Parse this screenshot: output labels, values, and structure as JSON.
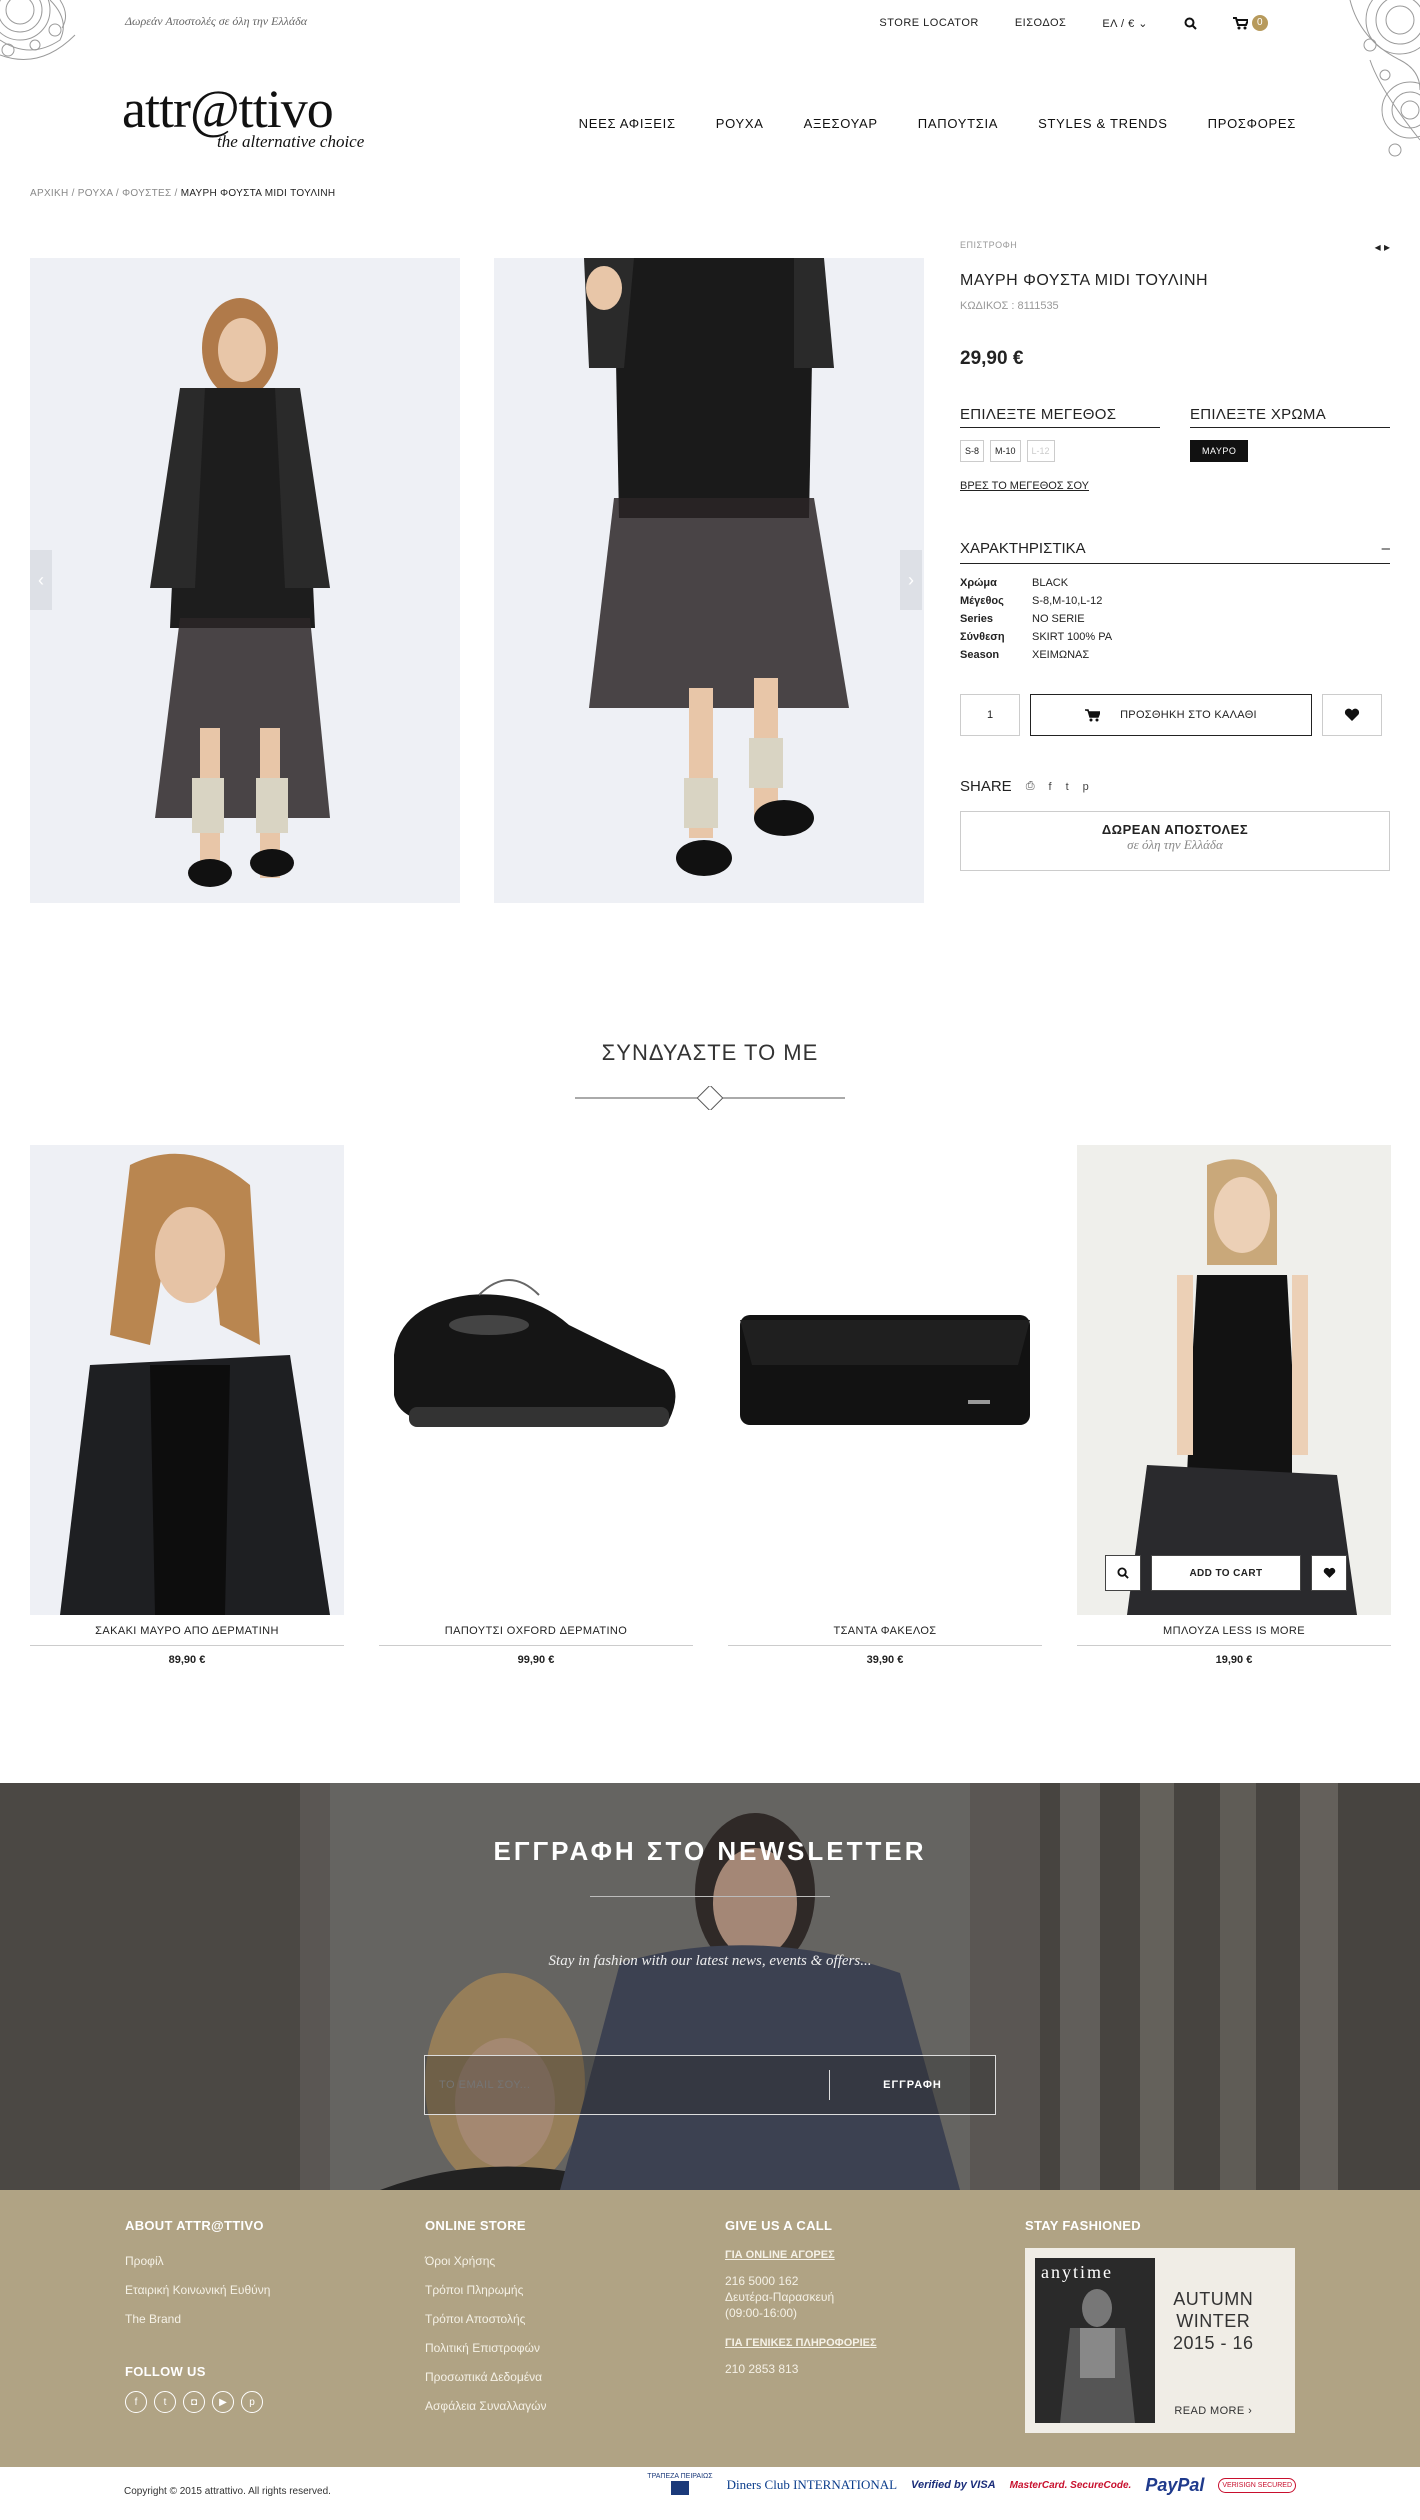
{
  "topbar": {
    "shipping_note": "Δωρεάν Αποστολές σε όλη την Ελλάδα",
    "store_locator": "STORE LOCATOR",
    "login": "ΕΙΣΟΔΟΣ",
    "lang_currency": "ΕΛ / €",
    "cart_count": "0"
  },
  "brand": {
    "name": "attr@ttivo",
    "tagline": "the alternative choice"
  },
  "nav": [
    "ΝΕΕΣ ΑΦΙΞΕΙΣ",
    "ΡΟΥΧΑ",
    "ΑΞΕΣΟΥΑΡ",
    "ΠΑΠΟΥΤΣΙΑ",
    "STYLES & TRENDS",
    "ΠΡΟΣΦΟΡΕΣ"
  ],
  "breadcrumb": [
    "ΑΡΧΙΚΗ",
    "ΡΟΥΧΑ",
    "ΦΟΥΣΤΕΣ",
    "ΜΑΥΡΗ ΦΟΥΣΤΑ MIDI ΤΟΥΛΙΝΗ"
  ],
  "product": {
    "back": "ΕΠΙΣΤΡΟΦΗ",
    "title": "ΜΑΥΡΗ ΦΟΥΣΤΑ MIDI ΤΟΥΛΙΝΗ",
    "code": "ΚΩΔΙΚΟΣ : 8111535",
    "price": "29,90 €",
    "size_heading": "ΕΠΙΛΕΞΤΕ ΜΕΓΕΘΟΣ",
    "sizes": [
      "S-8",
      "M-10",
      "L-12"
    ],
    "color_heading": "ΕΠΙΛΕΞΤΕ ΧΡΩΜΑ",
    "color": "ΜΑΥΡΟ",
    "find_size": "ΒΡΕΣ ΤΟ ΜΕΓΕΘΟΣ ΣΟΥ",
    "chars_heading": "ΧΑΡΑΚΤΗΡΙΣΤΙΚΑ",
    "chars_toggle": "–",
    "characteristics": [
      {
        "k": "Χρώμα",
        "v": "BLACK"
      },
      {
        "k": "Μέγεθος",
        "v": "S-8,M-10,L-12"
      },
      {
        "k": "Series",
        "v": "NO SERIE"
      },
      {
        "k": "Σύνθεση",
        "v": "SKIRT 100% PA"
      },
      {
        "k": "Season",
        "v": "ΧΕΙΜΩΝΑΣ"
      }
    ],
    "qty": "1",
    "add_to_cart": "ΠΡΟΣΘΗΚΗ ΣΤΟ ΚΑΛΑΘΙ",
    "share": "SHARE",
    "free_title": "ΔΩΡΕΑΝ ΑΠΟΣΤΟΛΕΣ",
    "free_sub": "σε όλη την Ελλάδα"
  },
  "combine": {
    "heading": "ΣΥΝΔΥΑΣΤΕ ΤΟ ΜΕ",
    "items": [
      {
        "name": "ΣΑΚΑΚΙ ΜΑΥΡΟ ΑΠΟ ΔΕΡΜΑΤΙΝΗ",
        "price": "89,90 €"
      },
      {
        "name": "ΠΑΠΟΥΤΣΙ OXFORD ΔΕΡΜΑΤΙΝΟ",
        "price": "99,90 €"
      },
      {
        "name": "ΤΣΑΝΤΑ ΦΑΚΕΛΟΣ",
        "price": "39,90 €"
      },
      {
        "name": "ΜΠΛΟΥΖΑ LESS IS MORE",
        "price": "19,90 €"
      }
    ],
    "hover_add": "ADD TO CART"
  },
  "newsletter": {
    "title": "ΕΓΓΡΑΦΗ ΣΤΟ NEWSLETTER",
    "subtitle": "Stay in fashion with our latest news, events & offers...",
    "placeholder": "ΤΟ EMAIL ΣΟΥ...",
    "button": "ΕΓΓΡΑΦΗ"
  },
  "footer": {
    "about_heading": "ABOUT ATTR@TTIVO",
    "about": [
      "Προφίλ",
      "Εταιρική Κοινωνική Ευθύνη",
      "The Brand"
    ],
    "follow": "FOLLOW US",
    "store_heading": "ONLINE STORE",
    "store": [
      "Όροι Χρήσης",
      "Τρόποι Πληρωμής",
      "Τρόποι Αποστολής",
      "Πολιτική Επιστροφών",
      "Προσωπικά Δεδομένα",
      "Ασφάλεια Συναλλαγών"
    ],
    "call_heading": "GIVE US A CALL",
    "call_online_label": "ΓΙΑ ONLINE ΑΓΟΡΕΣ",
    "call_online_phone": "216 5000 162",
    "call_online_days": "Δευτέρα-Παρασκευή",
    "call_online_hours": "(09:00-16:00)",
    "call_general_label": "ΓΙΑ ΓΕΝΙΚΕΣ ΠΛΗΡΟΦΟΡΙΕΣ",
    "call_general_phone": "210 2853 813",
    "fashion_heading": "STAY FASHIONED",
    "mag_brand": "anytime",
    "mag_l1": "AUTUMN",
    "mag_l2": "WINTER",
    "mag_l3": "2015 - 16",
    "mag_more": "READ MORE",
    "copyright": "Copyright © 2015 attrattivo. All rights reserved.",
    "payments": [
      "ΤΡΑΠΕΖΑ ΠΕΙΡΑΙΩΣ",
      "Diners Club INTERNATIONAL",
      "Verified by VISA",
      "MasterCard. SecureCode.",
      "PayPal",
      "VERISIGN SECURED"
    ]
  },
  "colors": {
    "accent": "#b79a5c",
    "footer_bg": "#b0a384",
    "text": "#222222"
  }
}
